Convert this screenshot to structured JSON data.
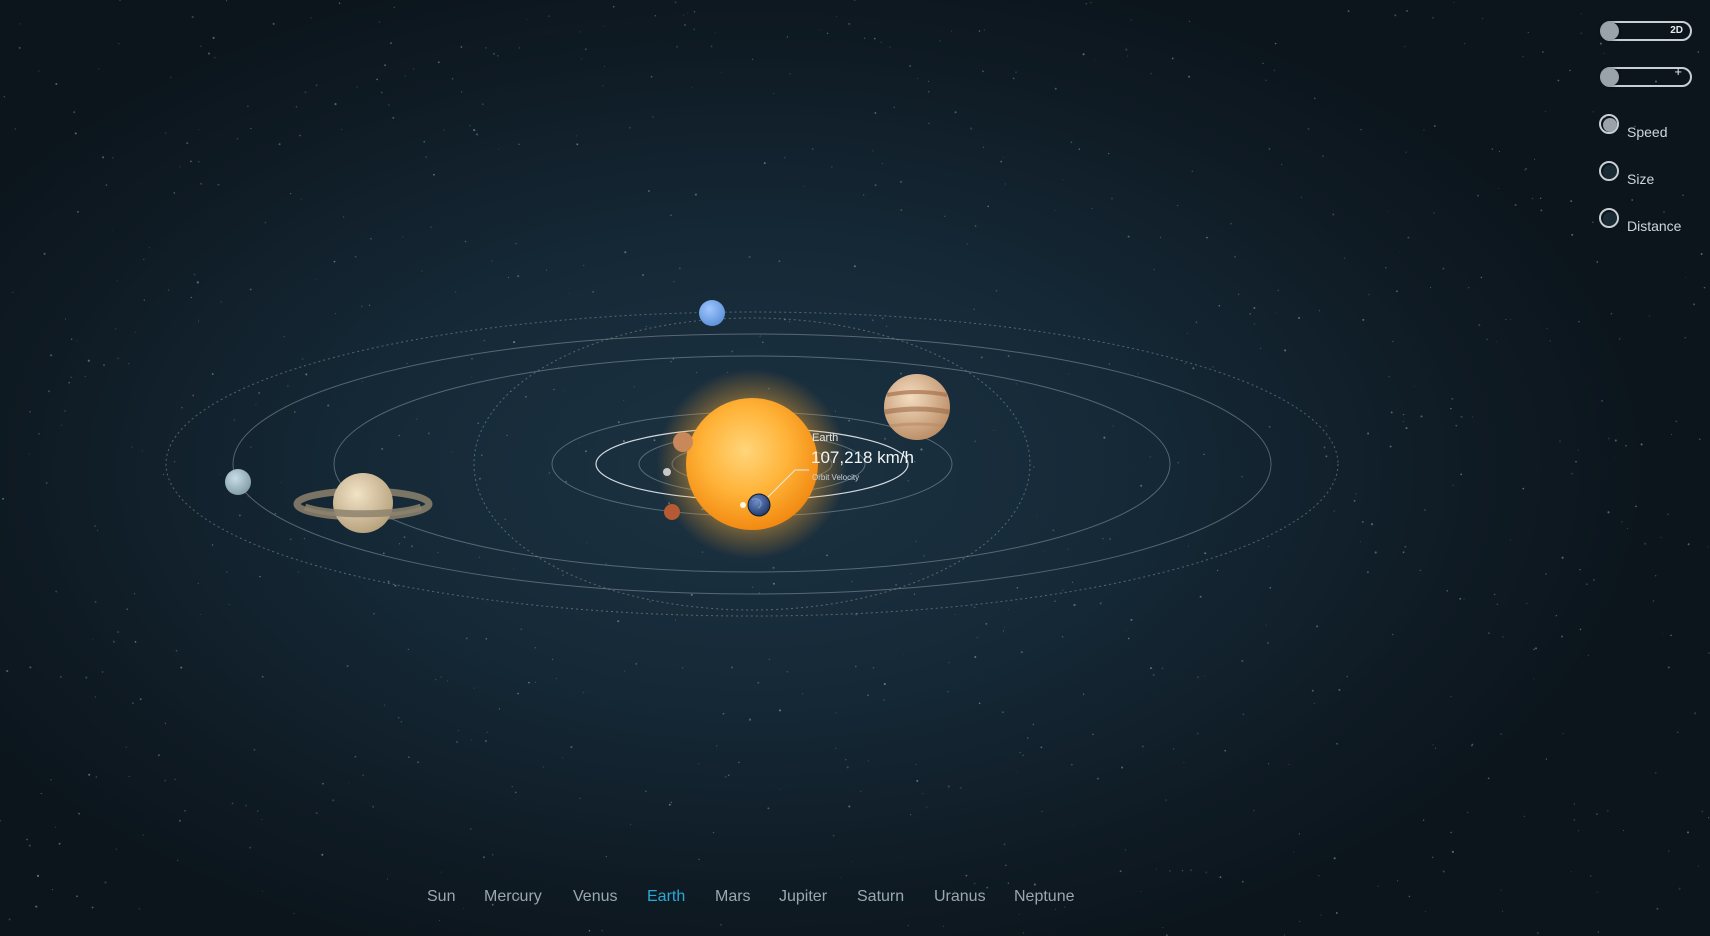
{
  "controls": {
    "view_toggle": {
      "label": "2D",
      "checked": false
    },
    "zoom_toggle": {
      "icon": "plus-icon",
      "checked": false
    },
    "scale_options": [
      {
        "label": "Speed",
        "selected": true
      },
      {
        "label": "Size",
        "selected": false
      },
      {
        "label": "Distance",
        "selected": false
      }
    ]
  },
  "tooltip": {
    "planet": "Earth",
    "value": "107,218 km/h",
    "caption": "Orbit Velocity"
  },
  "nav": {
    "selected": "Earth",
    "items": [
      "Sun",
      "Mercury",
      "Venus",
      "Earth",
      "Mars",
      "Jupiter",
      "Saturn",
      "Uranus",
      "Neptune"
    ]
  },
  "colors": {
    "accent": "#29a9d6",
    "nav_text": "#9aa7b0",
    "orbit": "#8a9aa3",
    "background": "#152836"
  }
}
